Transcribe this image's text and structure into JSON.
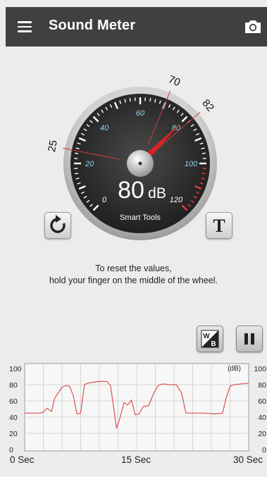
{
  "app": {
    "title": "Sound Meter"
  },
  "icons": {
    "menu": "hamburger-menu-icon",
    "camera": "camera-icon",
    "reset": "refresh-icon",
    "text": "text-T-icon",
    "wb": "white-black-toggle-icon",
    "pause": "pause-icon"
  },
  "gauge": {
    "reading": "80",
    "unit": "dB",
    "brand": "Smart Tools",
    "value": 80,
    "min_marker": "25",
    "avg_marker": "70",
    "max_marker": "82",
    "scale_min": 0,
    "scale_max": 120,
    "scale_labels": [
      "0",
      "20",
      "40",
      "60",
      "80",
      "100",
      "120"
    ]
  },
  "hint": {
    "line1": "To reset the values,",
    "line2": "hold your finger on the middle of the wheel."
  },
  "buttons": {
    "text_label": "T",
    "wb_top": "W",
    "wb_bottom": "B"
  },
  "chart_data": {
    "type": "line",
    "y_ticks_left": [
      "100",
      "80",
      "60",
      "40",
      "20",
      "0"
    ],
    "y_ticks_right": [
      "100",
      "80",
      "60",
      "40",
      "20",
      "0"
    ],
    "unit_label": "(dB)",
    "x_labels": [
      "0 Sec",
      "15 Sec",
      "30 Sec"
    ],
    "xlim": [
      0,
      30
    ],
    "ylim": [
      0,
      100
    ],
    "grid": true,
    "series": [
      {
        "values": [
          [
            0,
            45
          ],
          [
            1,
            45
          ],
          [
            2,
            45
          ],
          [
            2.5,
            46
          ],
          [
            3,
            51
          ],
          [
            3.6,
            47
          ],
          [
            4,
            63
          ],
          [
            4.5,
            70
          ],
          [
            5,
            77
          ],
          [
            5.6,
            79
          ],
          [
            6,
            78
          ],
          [
            6.5,
            67
          ],
          [
            7,
            44
          ],
          [
            7.5,
            45
          ],
          [
            8,
            80
          ],
          [
            8.5,
            82
          ],
          [
            9,
            83
          ],
          [
            10,
            84
          ],
          [
            11,
            84
          ],
          [
            11.5,
            79
          ],
          [
            12,
            46
          ],
          [
            12.3,
            26
          ],
          [
            12.8,
            40
          ],
          [
            13.3,
            58
          ],
          [
            13.8,
            55
          ],
          [
            14.3,
            61
          ],
          [
            14.8,
            43
          ],
          [
            15.3,
            44
          ],
          [
            15.9,
            53
          ],
          [
            16.6,
            54
          ],
          [
            17.3,
            70
          ],
          [
            17.9,
            79
          ],
          [
            18.5,
            81
          ],
          [
            19.5,
            80
          ],
          [
            20.3,
            80
          ],
          [
            21,
            70
          ],
          [
            21.6,
            45
          ],
          [
            22.5,
            45
          ],
          [
            24,
            45
          ],
          [
            25.5,
            44
          ],
          [
            26.5,
            45
          ],
          [
            27,
            64
          ],
          [
            27.5,
            78
          ],
          [
            28,
            80
          ],
          [
            29,
            81
          ],
          [
            30,
            82
          ]
        ]
      }
    ],
    "line_color": "#e05050"
  }
}
